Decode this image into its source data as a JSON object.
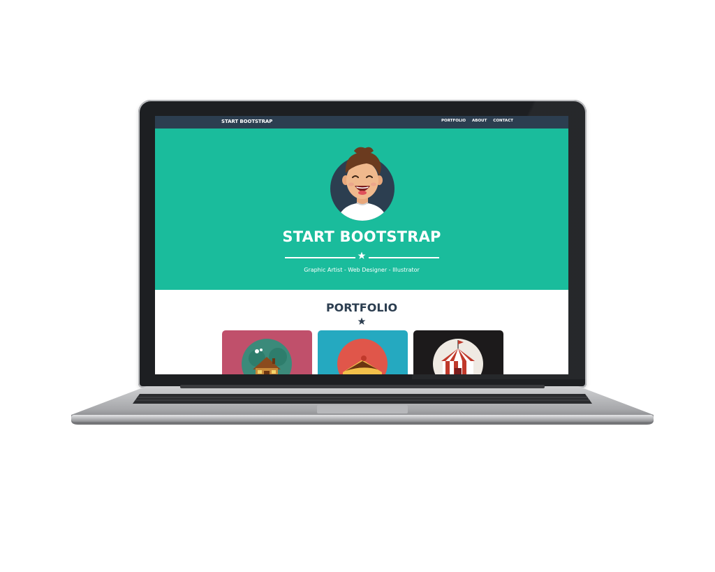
{
  "navbar": {
    "brand": "START BOOTSTRAP",
    "links": [
      "PORTFOLIO",
      "ABOUT",
      "CONTACT"
    ]
  },
  "hero": {
    "title": "START BOOTSTRAP",
    "tagline": "Graphic Artist - Web Designer - Illustrator"
  },
  "portfolio": {
    "title": "PORTFOLIO",
    "cards": [
      {
        "name": "cabin",
        "bg": "#c0506b"
      },
      {
        "name": "cake",
        "bg": "#25a9c0"
      },
      {
        "name": "circus-tent",
        "bg": "#1c1a1b"
      }
    ]
  },
  "colors": {
    "nav_bg": "#2c3e50",
    "hero_bg": "#1abc9c",
    "heading": "#2c3e50"
  }
}
